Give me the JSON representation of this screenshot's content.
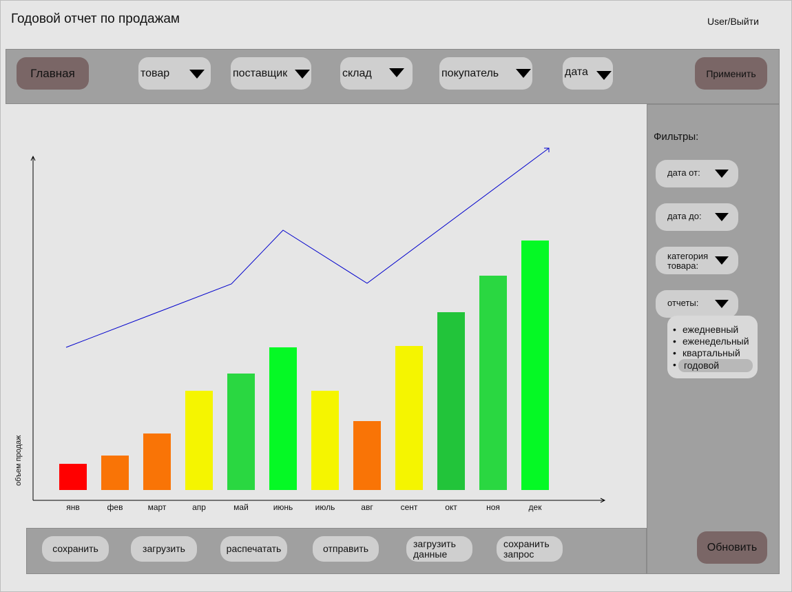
{
  "header": {
    "title": "Годовой отчет по продажам",
    "user_link": "User/Выйти"
  },
  "toolbar": {
    "home_label": "Главная",
    "dropdowns": [
      "товар",
      "поставщик",
      "склад",
      "покупатель",
      "дата"
    ],
    "apply_label": "Применить"
  },
  "sidebar": {
    "title": "Фильтры:",
    "filters": [
      "дата от:",
      "дата до:",
      "категория товара:",
      "отчеты:"
    ],
    "report_options": [
      "ежедневный",
      "еженедельный",
      "квартальный",
      "годовой"
    ],
    "selected_report": "годовой",
    "refresh_label": "Обновить"
  },
  "bottom": {
    "buttons": [
      "сохранить",
      "загрузить",
      "распечатать",
      "отправить",
      "загрузить данные",
      "сохранить запрос"
    ]
  },
  "chart_data": {
    "type": "bar",
    "title": "",
    "xlabel": "",
    "ylabel": "объем продаж",
    "categories": [
      "янв",
      "фев",
      "март",
      "апр",
      "май",
      "июнь",
      "июль",
      "авг",
      "сент",
      "окт",
      "ноя",
      "дек"
    ],
    "values": [
      38,
      50,
      82,
      144,
      169,
      207,
      144,
      100,
      209,
      258,
      311,
      362
    ],
    "bar_colors": [
      "#ff0000",
      "#f97406",
      "#f97406",
      "#f5f500",
      "#2ad741",
      "#05f925",
      "#f5f500",
      "#f97406",
      "#f5f500",
      "#22c43a",
      "#2ad741",
      "#05f925"
    ],
    "trend_line": {
      "color": "#0000cc",
      "values": [
        207,
        253,
        299,
        377,
        300,
        496
      ]
    },
    "ylim": [
      0,
      485
    ],
    "grid": false
  },
  "colors": {
    "accent_button": "#7a6666",
    "panel": "#a0a0a0",
    "control": "#cfcfcf",
    "background": "#e6e6e6"
  }
}
